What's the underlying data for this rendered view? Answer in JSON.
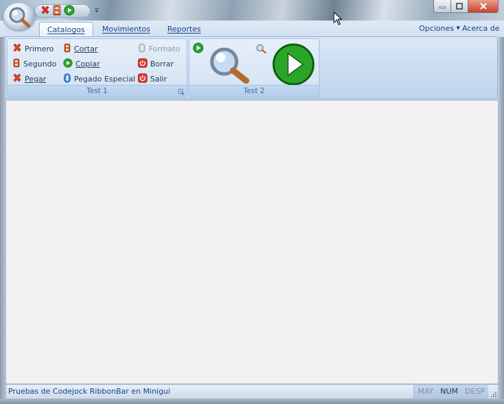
{
  "qat": {
    "icons": [
      "close-x-icon",
      "film-icon",
      "play-icon"
    ],
    "more": "chevron-down-icon"
  },
  "tabs": [
    {
      "label": "Catalogos",
      "active": true
    },
    {
      "label": "Movimientos",
      "active": false
    },
    {
      "label": "Reportes",
      "active": false
    }
  ],
  "right_menu": {
    "opciones": "Opciones",
    "acerca": "Acerca de"
  },
  "groups": {
    "test1": {
      "caption": "Test 1",
      "buttons": {
        "primero": "Primero",
        "segundo": "Segundo",
        "pegar": "Pegar",
        "cortar": "Cortar",
        "copiar": "Copiar",
        "pegado_especial": "Pegado Especial",
        "formato": "Formato",
        "borrar": "Borrar",
        "salir": "Salir"
      }
    },
    "test2": {
      "caption": "Test 2"
    }
  },
  "status": {
    "text": "Pruebas de Codejock RibbonBar  en Minigui",
    "indicators": [
      {
        "label": "MAY",
        "on": false
      },
      {
        "label": "NUM",
        "on": true
      },
      {
        "label": "DESP",
        "on": false
      }
    ]
  },
  "colors": {
    "accent": "#15428b",
    "ribbon": "#d8e5f4",
    "content": "#f2f2f2",
    "close": "#c7432a"
  }
}
